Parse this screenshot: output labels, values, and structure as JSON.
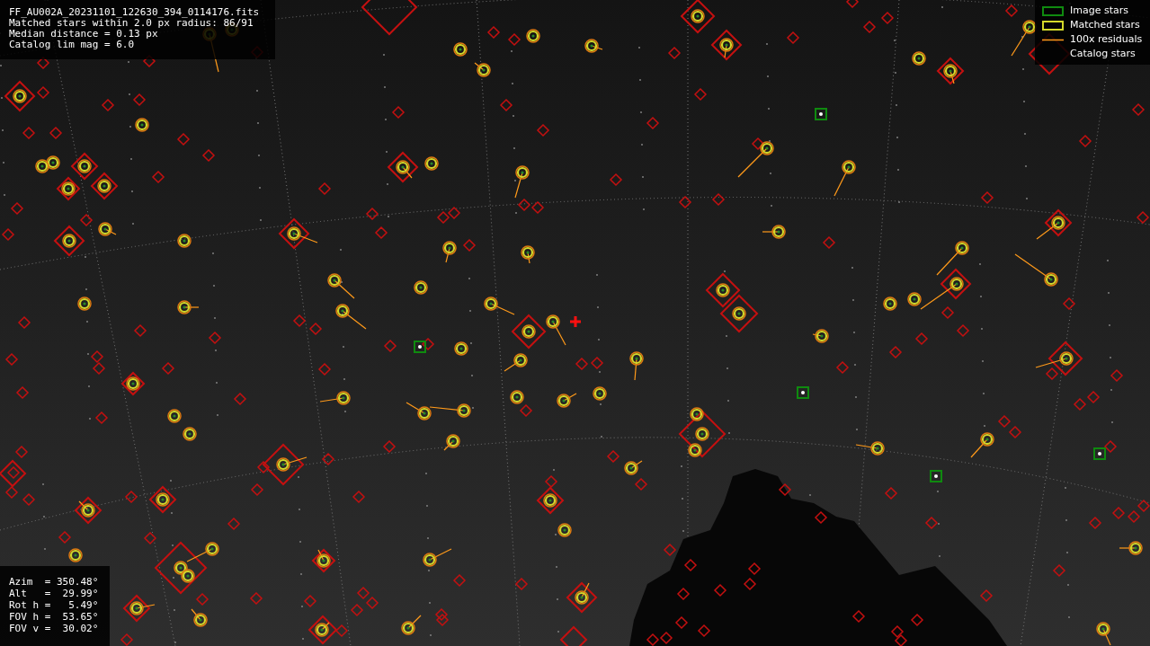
{
  "info_box": {
    "lines": [
      "FF_AU002A_20231101_122630_394_0114176.fits",
      "Matched stars within 2.0 px radius: 86/91",
      "Median distance = 0.13 px",
      "Catalog lim mag = 6.0"
    ]
  },
  "legend": [
    {
      "kind": "image",
      "label": "Image stars"
    },
    {
      "kind": "matched",
      "label": "Matched stars"
    },
    {
      "kind": "residual",
      "label": "100x residuals"
    },
    {
      "kind": "catalog",
      "label": "Catalog stars"
    }
  ],
  "pointing_box": {
    "lines": [
      "Azim  = 350.48°",
      "Alt   =  29.99°",
      "Rot h =   5.49°",
      "FOV h =  53.65°",
      "FOV v =  30.02°"
    ]
  }
}
